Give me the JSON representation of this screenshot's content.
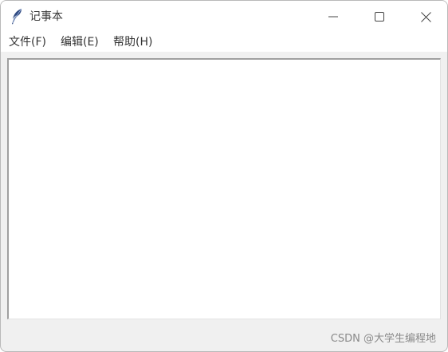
{
  "window": {
    "title": "记事本",
    "icon": "feather-icon"
  },
  "window_controls": {
    "minimize_icon": "minimize-icon",
    "maximize_icon": "maximize-icon",
    "close_icon": "close-icon"
  },
  "menubar": {
    "items": [
      {
        "label": "文件(F)"
      },
      {
        "label": "编辑(E)"
      },
      {
        "label": "帮助(H)"
      }
    ]
  },
  "editor": {
    "value": ""
  },
  "watermark": {
    "text": "CSDN @大学生编程地"
  },
  "colors": {
    "window_bg": "#f0f0f0",
    "titlebar_bg": "#ffffff",
    "text": "#333333",
    "feather": "#2f4a82"
  }
}
